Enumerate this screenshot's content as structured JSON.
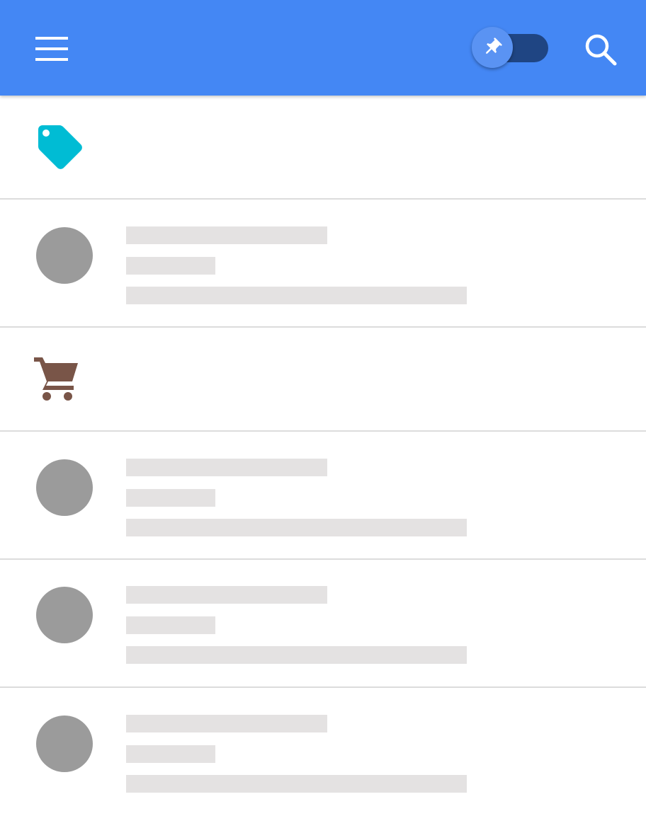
{
  "app_bar": {
    "background_color": "#4487f4",
    "menu_icon": "hamburger-menu-icon",
    "pin_toggle": {
      "icon": "pushpin-icon",
      "checked": true,
      "track_color": "#1f4583",
      "thumb_color": "#5a93f3"
    },
    "search_icon": "search-icon"
  },
  "list": {
    "sections": [
      {
        "icon": "label-tag-icon",
        "icon_color": "#00bcd4",
        "items": [
          {
            "state": "loading-placeholder"
          }
        ]
      },
      {
        "icon": "shopping-cart-icon",
        "icon_color": "#795548",
        "items": [
          {
            "state": "loading-placeholder"
          },
          {
            "state": "loading-placeholder"
          },
          {
            "state": "loading-placeholder"
          }
        ]
      }
    ],
    "placeholder_colors": {
      "avatar": "#9b9b9b",
      "text_bar": "#e4e2e2",
      "divider": "#dcdcdc"
    }
  }
}
